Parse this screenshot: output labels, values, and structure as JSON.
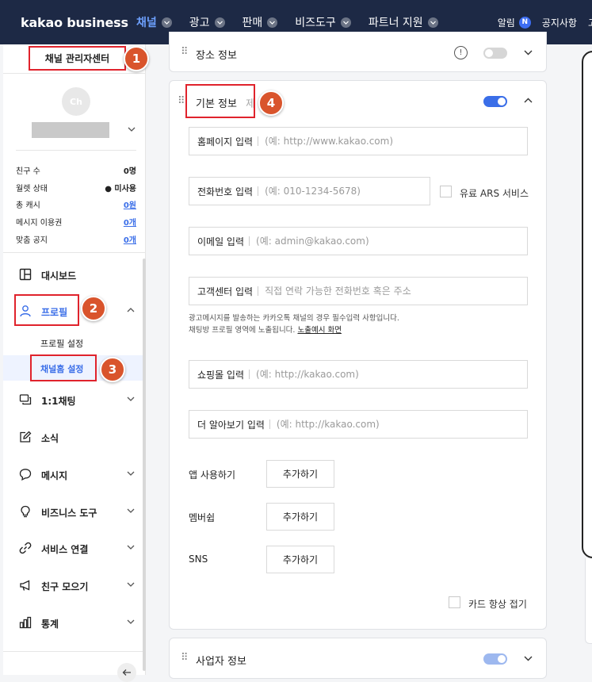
{
  "nav": {
    "brand": "kakao business",
    "items": [
      {
        "label": "채널",
        "active": true
      },
      {
        "label": "광고",
        "active": false
      },
      {
        "label": "판매",
        "active": false
      },
      {
        "label": "비즈도구",
        "active": false
      },
      {
        "label": "파트너 지원",
        "active": false
      }
    ],
    "alarm": "알림",
    "alarm_badge": "N",
    "notice": "공지사항",
    "cut": "고"
  },
  "sidebar": {
    "center_title": "채널 관리자센터",
    "avatar_text": "Ch",
    "stats": [
      {
        "label": "친구 수",
        "value": "0명"
      },
      {
        "label": "월렛 상태",
        "value": "● 미사용"
      },
      {
        "label": "총 캐시",
        "value": "0원"
      },
      {
        "label": "메시지 이용권",
        "value": "0개"
      },
      {
        "label": "맞춤 공지",
        "value": "0개"
      }
    ],
    "menu": {
      "dashboard": "대시보드",
      "profile": "프로필",
      "profile_settings": "프로필 설정",
      "channel_home": "채널홈 설정",
      "chat": "1:1채팅",
      "news": "소식",
      "message": "메시지",
      "biz_tools": "비즈니스 도구",
      "service_link": "서비스 연결",
      "friend_gather": "친구 모으기",
      "stats": "통계"
    }
  },
  "steps": [
    "1",
    "2",
    "3",
    "4"
  ],
  "main": {
    "place_card_title": "장소 정보",
    "basic_card_title": "기본 정보",
    "basic_card_title_extra": "제",
    "fields": {
      "homepage": {
        "label": "홈페이지 입력",
        "placeholder": "(예: http://www.kakao.com)"
      },
      "phone": {
        "label": "전화번호 입력",
        "placeholder": "(예: 010-1234-5678)"
      },
      "email": {
        "label": "이메일 입력",
        "placeholder": "(예: admin@kakao.com)"
      },
      "cs": {
        "label": "고객센터 입력",
        "placeholder": "직접 연락 가능한 전화번호 혹은 주소"
      },
      "shop": {
        "label": "쇼핑몰 입력",
        "placeholder": "(예: http://kakao.com)"
      },
      "more": {
        "label": "더 알아보기 입력",
        "placeholder": "(예: http://kakao.com)"
      }
    },
    "ars_label": "유료 ARS 서비스",
    "note_line1": "광고메시지를 발송하는 카카오톡 채널의 경우 필수입력 사항입니다.",
    "note_line2_prefix": "채팅방 프로필 영역에 노출됩니다.",
    "note_link": "노출예시 화면",
    "rows": [
      {
        "label": "앱 사용하기",
        "button": "추가하기"
      },
      {
        "label": "멤버쉽",
        "button": "추가하기"
      },
      {
        "label": "SNS",
        "button": "추가하기"
      }
    ],
    "card_always_fold": "카드 항상 접기",
    "biz_card_title": "사업자 정보"
  },
  "colors": {
    "nav_bg": "#1d2945",
    "accent": "#3a6ee8",
    "highlight": "#e0232c",
    "step": "#d9542c"
  }
}
